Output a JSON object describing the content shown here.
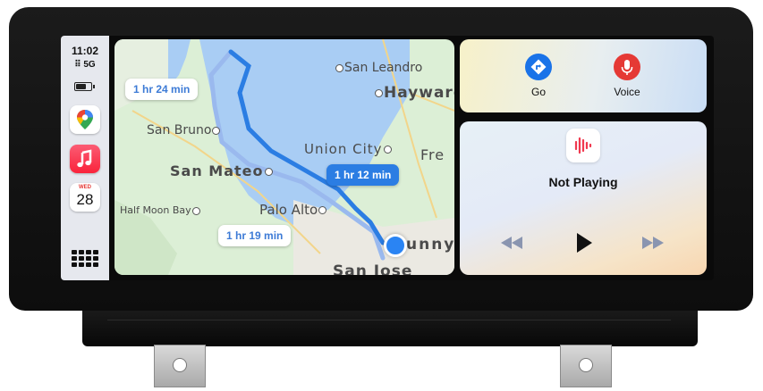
{
  "status": {
    "time": "11:02",
    "signal": "5G"
  },
  "sidebar": {
    "apps": [
      {
        "name": "Google Maps",
        "icon": "google-maps-icon"
      },
      {
        "name": "Music",
        "icon": "music-note-icon"
      },
      {
        "name": "Calendar",
        "icon": "calendar-icon",
        "day": "WED",
        "date": "28"
      }
    ],
    "grid_icon": "app-grid-icon"
  },
  "map": {
    "places": {
      "san_leandro": "San Leandro",
      "hayward": "Hayward",
      "san_bruno": "San Bruno",
      "union_city": "Union City",
      "fremont_partial": "Fre",
      "san_mateo": "San Mateo",
      "half_moon_bay": "Half Moon Bay",
      "palo_alto": "Palo Alto",
      "sunnyvale_partial": "unny",
      "san_jose_partial": "San Jose"
    },
    "routes": {
      "alt_north": "1 hr 24 min",
      "main": "1 hr 12 min",
      "alt_south": "1 hr 19 min"
    },
    "colors": {
      "main_route": "#2b7de3",
      "alt_route": "#9ab9ee",
      "water": "#a9cdf4",
      "land": "#dcefd6"
    }
  },
  "actions": {
    "go_label": "Go",
    "voice_label": "Voice"
  },
  "now_playing": {
    "status": "Not Playing",
    "controls": [
      "previous-icon",
      "play-icon",
      "next-icon"
    ]
  },
  "colors": {
    "go": "#1a73e8",
    "voice": "#e53935",
    "music": "#fa233b"
  }
}
